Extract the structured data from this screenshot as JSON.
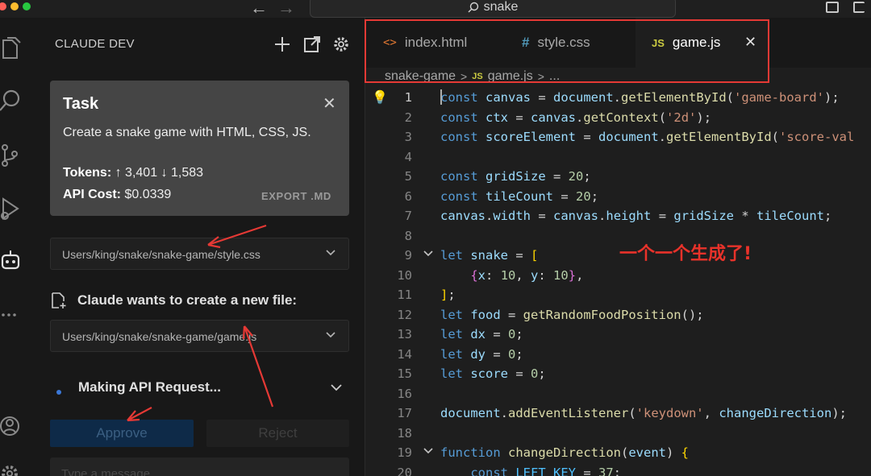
{
  "colors": {
    "accent_red": "#e53935",
    "keyword": "#569cd6",
    "variable": "#9cdcfe",
    "function": "#dcdcaa",
    "string": "#ce9178",
    "number": "#b5cea8"
  },
  "title_bar": {
    "search_text": "snake"
  },
  "sidebar": {
    "title": "CLAUDE DEV",
    "task": {
      "title": "Task",
      "description": "Create a snake game with HTML, CSS, JS.",
      "tokens_label": "Tokens:",
      "tokens_up": "↑ 3,401",
      "tokens_down": "↓ 1,583",
      "cost_label": "API Cost:",
      "cost_value": "$0.0339",
      "export_label": "EXPORT .MD"
    },
    "file_path_1": "Users/king/snake/snake-game/style.css",
    "create_file_label": "Claude wants to create a new file:",
    "file_path_2": "Users/king/snake/snake-game/game.js",
    "status": "Making API Request...",
    "approve_label": "Approve",
    "reject_label": "Reject",
    "message_placeholder": "Type a message..."
  },
  "editor": {
    "tabs": [
      {
        "label": "index.html",
        "icon": "html-icon",
        "glyph": "<>"
      },
      {
        "label": "style.css",
        "icon": "css-icon",
        "glyph": "#"
      },
      {
        "label": "game.js",
        "icon": "js-icon",
        "glyph": "JS"
      }
    ],
    "breadcrumb": {
      "folder": "snake-game",
      "file_icon": "JS",
      "file": "game.js",
      "more": "..."
    },
    "lines": [
      {
        "n": "1",
        "tokens": [
          [
            "k",
            "const"
          ],
          [
            "p",
            " "
          ],
          [
            "v",
            "canvas"
          ],
          [
            "p",
            " = "
          ],
          [
            "v",
            "document"
          ],
          [
            "p",
            "."
          ],
          [
            "f",
            "getElementById"
          ],
          [
            "p",
            "("
          ],
          [
            "s",
            "'game-board'"
          ],
          [
            "p",
            ");"
          ]
        ]
      },
      {
        "n": "2",
        "tokens": [
          [
            "k",
            "const"
          ],
          [
            "p",
            " "
          ],
          [
            "v",
            "ctx"
          ],
          [
            "p",
            " = "
          ],
          [
            "v",
            "canvas"
          ],
          [
            "p",
            "."
          ],
          [
            "f",
            "getContext"
          ],
          [
            "p",
            "("
          ],
          [
            "s",
            "'2d'"
          ],
          [
            "p",
            ");"
          ]
        ]
      },
      {
        "n": "3",
        "tokens": [
          [
            "k",
            "const"
          ],
          [
            "p",
            " "
          ],
          [
            "v",
            "scoreElement"
          ],
          [
            "p",
            " = "
          ],
          [
            "v",
            "document"
          ],
          [
            "p",
            "."
          ],
          [
            "f",
            "getElementById"
          ],
          [
            "p",
            "("
          ],
          [
            "s",
            "'score-val"
          ]
        ]
      },
      {
        "n": "4",
        "tokens": []
      },
      {
        "n": "5",
        "tokens": [
          [
            "k",
            "const"
          ],
          [
            "p",
            " "
          ],
          [
            "v",
            "gridSize"
          ],
          [
            "p",
            " = "
          ],
          [
            "n",
            "20"
          ],
          [
            "p",
            ";"
          ]
        ]
      },
      {
        "n": "6",
        "tokens": [
          [
            "k",
            "const"
          ],
          [
            "p",
            " "
          ],
          [
            "v",
            "tileCount"
          ],
          [
            "p",
            " = "
          ],
          [
            "n",
            "20"
          ],
          [
            "p",
            ";"
          ]
        ]
      },
      {
        "n": "7",
        "tokens": [
          [
            "v",
            "canvas"
          ],
          [
            "p",
            "."
          ],
          [
            "v",
            "width"
          ],
          [
            "p",
            " = "
          ],
          [
            "v",
            "canvas"
          ],
          [
            "p",
            "."
          ],
          [
            "v",
            "height"
          ],
          [
            "p",
            " = "
          ],
          [
            "v",
            "gridSize"
          ],
          [
            "p",
            " * "
          ],
          [
            "v",
            "tileCount"
          ],
          [
            "p",
            ";"
          ]
        ]
      },
      {
        "n": "8",
        "tokens": []
      },
      {
        "n": "9",
        "tokens": [
          [
            "k",
            "let"
          ],
          [
            "p",
            " "
          ],
          [
            "v",
            "snake"
          ],
          [
            "p",
            " = "
          ],
          [
            "y",
            "["
          ]
        ]
      },
      {
        "n": "10",
        "tokens": [
          [
            "p",
            "    "
          ],
          [
            "m",
            "{"
          ],
          [
            "v",
            "x"
          ],
          [
            "p",
            ": "
          ],
          [
            "n",
            "10"
          ],
          [
            "p",
            ", "
          ],
          [
            "v",
            "y"
          ],
          [
            "p",
            ": "
          ],
          [
            "n",
            "10"
          ],
          [
            "m",
            "}"
          ],
          [
            "p",
            ","
          ]
        ]
      },
      {
        "n": "11",
        "tokens": [
          [
            "y",
            "]"
          ],
          [
            "p",
            ";"
          ]
        ]
      },
      {
        "n": "12",
        "tokens": [
          [
            "k",
            "let"
          ],
          [
            "p",
            " "
          ],
          [
            "v",
            "food"
          ],
          [
            "p",
            " = "
          ],
          [
            "f",
            "getRandomFoodPosition"
          ],
          [
            "p",
            "();"
          ]
        ]
      },
      {
        "n": "13",
        "tokens": [
          [
            "k",
            "let"
          ],
          [
            "p",
            " "
          ],
          [
            "v",
            "dx"
          ],
          [
            "p",
            " = "
          ],
          [
            "n",
            "0"
          ],
          [
            "p",
            ";"
          ]
        ]
      },
      {
        "n": "14",
        "tokens": [
          [
            "k",
            "let"
          ],
          [
            "p",
            " "
          ],
          [
            "v",
            "dy"
          ],
          [
            "p",
            " = "
          ],
          [
            "n",
            "0"
          ],
          [
            "p",
            ";"
          ]
        ]
      },
      {
        "n": "15",
        "tokens": [
          [
            "k",
            "let"
          ],
          [
            "p",
            " "
          ],
          [
            "v",
            "score"
          ],
          [
            "p",
            " = "
          ],
          [
            "n",
            "0"
          ],
          [
            "p",
            ";"
          ]
        ]
      },
      {
        "n": "16",
        "tokens": []
      },
      {
        "n": "17",
        "tokens": [
          [
            "v",
            "document"
          ],
          [
            "p",
            "."
          ],
          [
            "f",
            "addEventListener"
          ],
          [
            "p",
            "("
          ],
          [
            "s",
            "'keydown'"
          ],
          [
            "p",
            ", "
          ],
          [
            "v",
            "changeDirection"
          ],
          [
            "p",
            ");"
          ]
        ]
      },
      {
        "n": "18",
        "tokens": []
      },
      {
        "n": "19",
        "tokens": [
          [
            "k",
            "function"
          ],
          [
            "p",
            " "
          ],
          [
            "f",
            "changeDirection"
          ],
          [
            "p",
            "("
          ],
          [
            "v",
            "event"
          ],
          [
            "p",
            ") "
          ],
          [
            "y",
            "{"
          ]
        ]
      },
      {
        "n": "20",
        "tokens": [
          [
            "p",
            "    "
          ],
          [
            "k",
            "const"
          ],
          [
            "p",
            " "
          ],
          [
            "c",
            "LEFT_KEY"
          ],
          [
            "p",
            " = "
          ],
          [
            "n",
            "37"
          ],
          [
            "p",
            ";"
          ]
        ]
      }
    ]
  },
  "annotation": "一个一个生成了!"
}
